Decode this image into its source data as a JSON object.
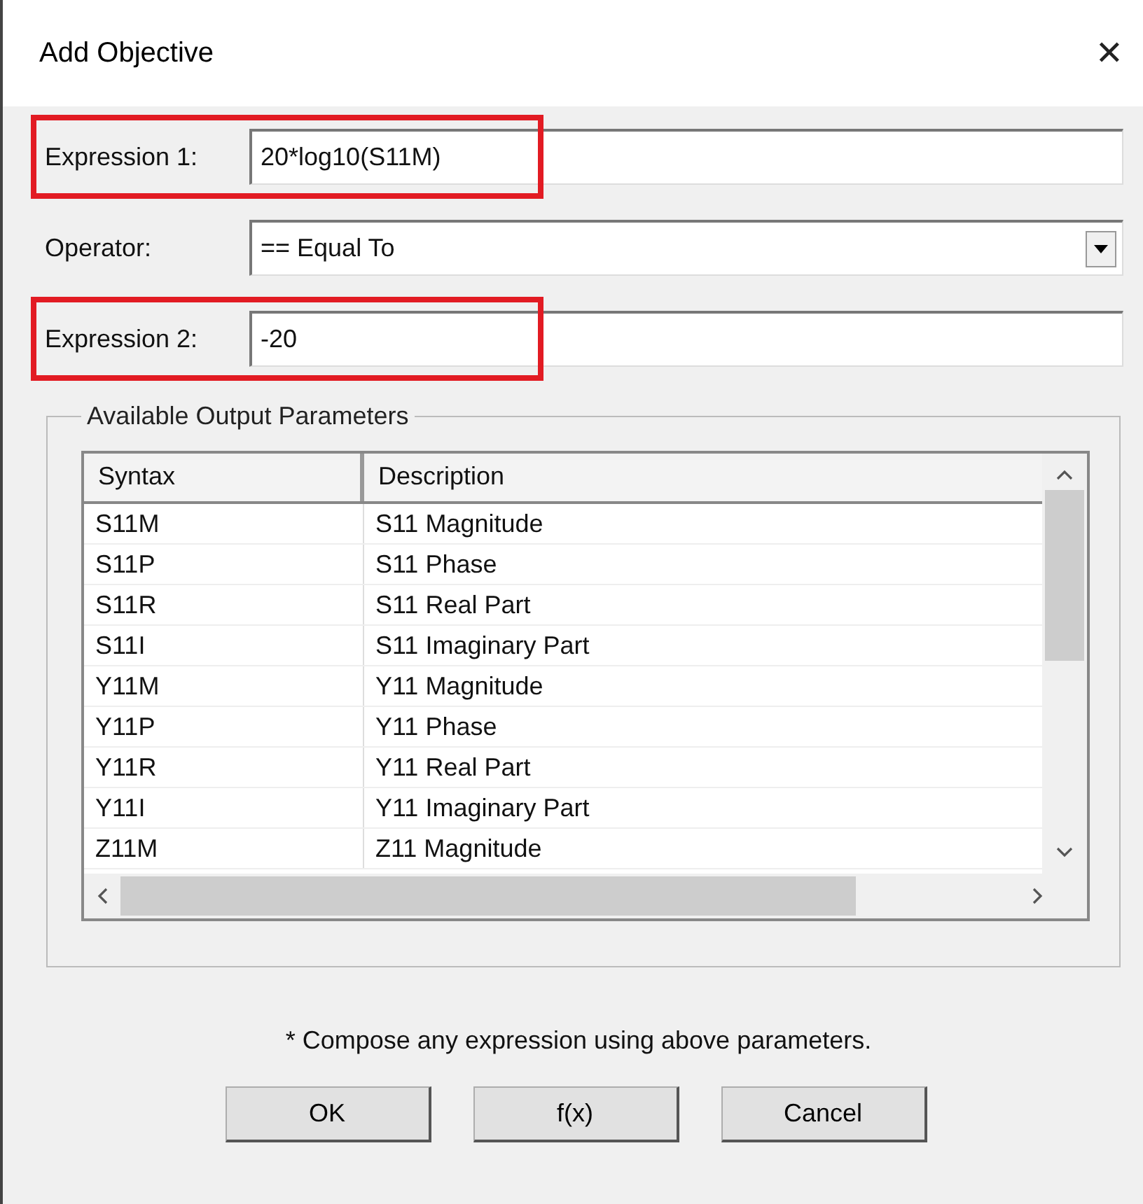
{
  "window": {
    "title": "Add Objective",
    "close": "✕"
  },
  "fields": [
    {
      "kind": "text",
      "label": "Expression 1:",
      "value": "20*log10(S11M)",
      "highlighted": true
    },
    {
      "kind": "dropdown",
      "label": "Operator:",
      "value": "== Equal To",
      "highlighted": false
    },
    {
      "kind": "text",
      "label": "Expression 2:",
      "value": "-20",
      "highlighted": true
    }
  ],
  "group": {
    "title": "Available Output Parameters",
    "table": {
      "columns": [
        "Syntax",
        "Description"
      ],
      "rows": [
        [
          "S11M",
          "S11 Magnitude"
        ],
        [
          "S11P",
          "S11 Phase"
        ],
        [
          "S11R",
          "S11 Real Part"
        ],
        [
          "S11I",
          "S11 Imaginary Part"
        ],
        [
          "Y11M",
          "Y11 Magnitude"
        ],
        [
          "Y11P",
          "Y11 Phase"
        ],
        [
          "Y11R",
          "Y11 Real Part"
        ],
        [
          "Y11I",
          "Y11 Imaginary Part"
        ],
        [
          "Z11M",
          "Z11 Magnitude"
        ]
      ]
    }
  },
  "note": "* Compose any expression using above parameters.",
  "buttons": [
    "OK",
    "f(x)",
    "Cancel"
  ]
}
